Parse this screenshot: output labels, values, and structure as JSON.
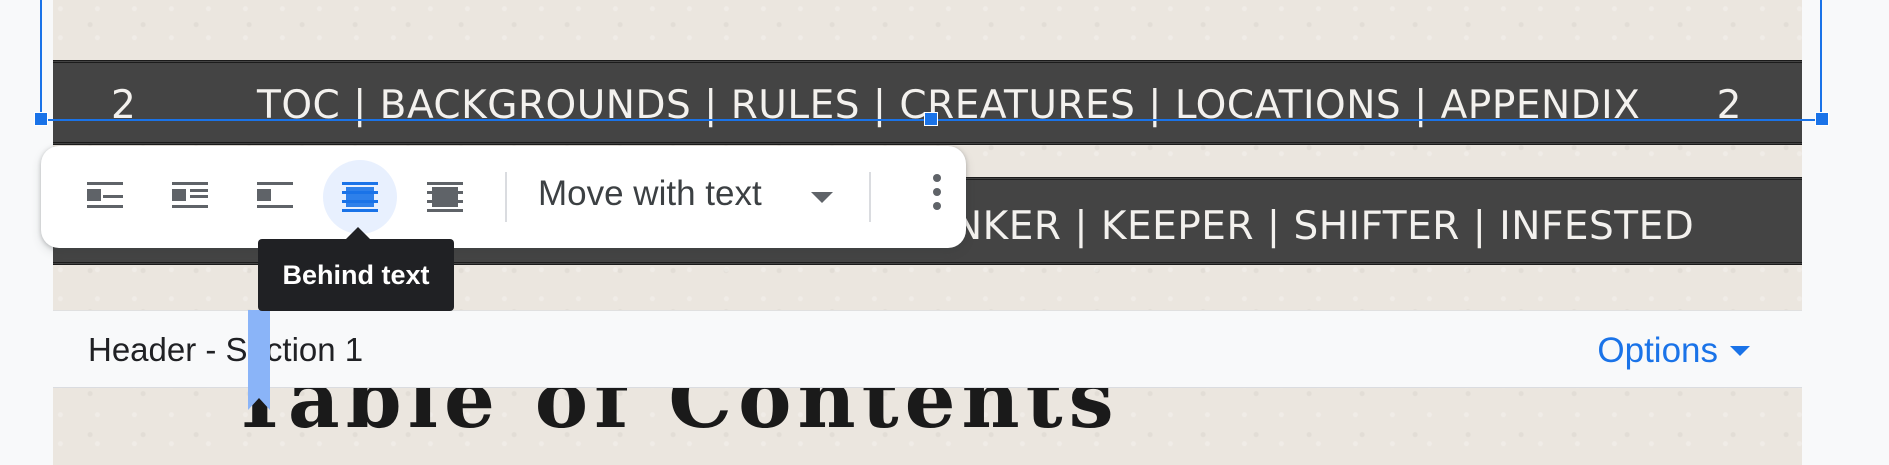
{
  "document": {
    "top_band": {
      "page_number_left": "2",
      "nav_text": "TOC | BACKGROUNDS | RULES | CREATURES | LOCATIONS | APPENDIX",
      "page_number_right": "2"
    },
    "second_band": {
      "text": "NKER | KEEPER | SHIFTER | INFESTED"
    },
    "partial_heading": "Table of Contents"
  },
  "header_bar": {
    "label": "Header - Section 1",
    "options_label": "Options"
  },
  "image_toolbar": {
    "wrap_options": [
      {
        "name": "inline",
        "icon": "wrap-inline-icon",
        "active": false
      },
      {
        "name": "wrap-text",
        "icon": "wrap-text-icon",
        "active": false
      },
      {
        "name": "break-text",
        "icon": "break-text-icon",
        "active": false
      },
      {
        "name": "behind-text",
        "icon": "behind-text-icon",
        "active": true
      },
      {
        "name": "in-front-of-text",
        "icon": "in-front-of-text-icon",
        "active": false
      }
    ],
    "position_mode": "Move with text",
    "more_icon": "more-vert-icon"
  },
  "tooltip": {
    "text": "Behind text"
  },
  "colors": {
    "accent": "#1a73e8",
    "band": "#444444",
    "tooltip_bg": "#202124",
    "active_bg": "#e8f0fe"
  }
}
